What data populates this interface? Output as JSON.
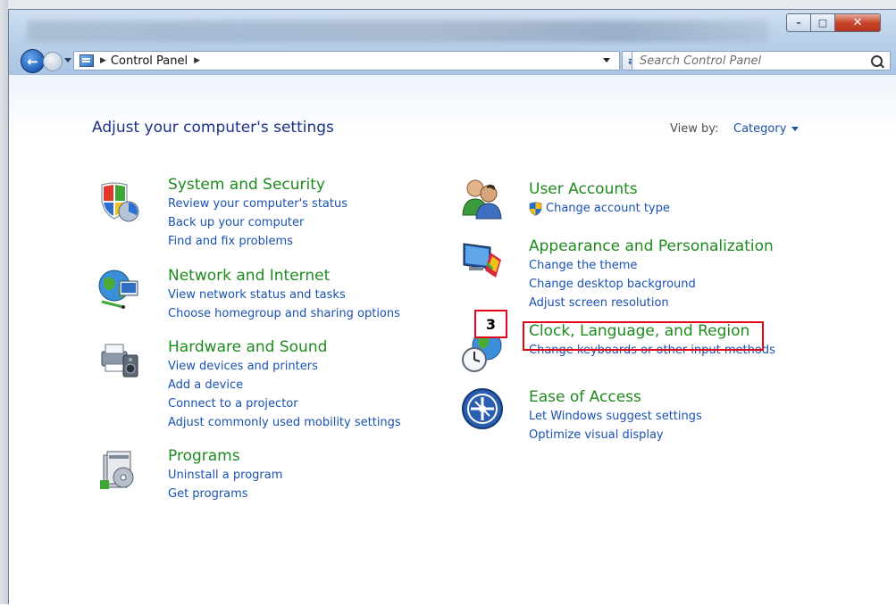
{
  "window": {
    "title_buttons": {
      "minimize": "–",
      "maximize": "□",
      "close": "✕"
    }
  },
  "address_bar": {
    "breadcrumbs": [
      "Control Panel"
    ],
    "breadcrumb_separator": "▶",
    "refresh_glyph": "⇄"
  },
  "search": {
    "placeholder": "Search Control Panel"
  },
  "main": {
    "heading": "Adjust your computer's settings",
    "view_by_label": "View by:",
    "view_by_value": "Category"
  },
  "categories": {
    "system_security": {
      "title": "System and Security",
      "links": [
        "Review your computer's status",
        "Back up your computer",
        "Find and fix problems"
      ],
      "icon": "shield-icon"
    },
    "network_internet": {
      "title": "Network and Internet",
      "links": [
        "View network status and tasks",
        "Choose homegroup and sharing options"
      ],
      "icon": "network-globe-icon"
    },
    "hardware_sound": {
      "title": "Hardware and Sound",
      "links": [
        "View devices and printers",
        "Add a device",
        "Connect to a projector",
        "Adjust commonly used mobility settings"
      ],
      "icon": "printer-speaker-icon"
    },
    "programs": {
      "title": "Programs",
      "links": [
        "Uninstall a program",
        "Get programs"
      ],
      "icon": "programs-box-icon"
    },
    "user_accounts": {
      "title": "User Accounts",
      "links": [
        "Change account type"
      ],
      "icon": "users-icon"
    },
    "appearance": {
      "title": "Appearance and Personalization",
      "links": [
        "Change the theme",
        "Change desktop background",
        "Adjust screen resolution"
      ],
      "icon": "monitor-brush-icon"
    },
    "clock_region": {
      "title": "Clock, Language, and Region",
      "links": [
        "Change keyboards or other input methods"
      ],
      "icon": "clock-globe-icon"
    },
    "ease_access": {
      "title": "Ease of Access",
      "links": [
        "Let Windows suggest settings",
        "Optimize visual display"
      ],
      "icon": "ease-of-access-icon"
    }
  },
  "annotation": {
    "step_number": "3",
    "color": "#e3061a"
  },
  "colors": {
    "category_title": "#1e8a1e",
    "link": "#1a51b0",
    "heading": "#1e3287"
  }
}
